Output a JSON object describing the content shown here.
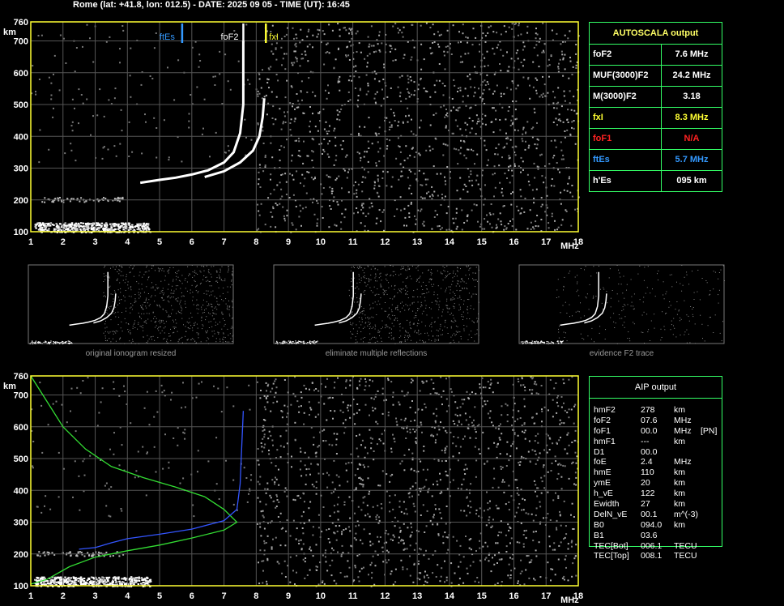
{
  "header": {
    "title": "Rome (lat: +41.8, lon: 012.5) - DATE: 2025 09 05 - TIME (UT): 16:45"
  },
  "chart_data": [
    {
      "type": "scatter",
      "panel": "main-ionogram",
      "xlabel": "MHz",
      "ylabel": "km",
      "xlim": [
        1,
        18
      ],
      "ylim": [
        100,
        760
      ],
      "x_ticks": [
        1,
        2,
        3,
        4,
        5,
        6,
        7,
        8,
        9,
        10,
        11,
        12,
        13,
        14,
        15,
        16,
        17,
        18
      ],
      "y_ticks": [
        100,
        200,
        300,
        400,
        500,
        600,
        700,
        760
      ],
      "grid": true,
      "markers": [
        {
          "label": "ftEs",
          "x": 5.7,
          "color": "#3399ff"
        },
        {
          "label": "foF2",
          "x": 7.6,
          "color": "#ffffff"
        },
        {
          "label": "fxI",
          "x": 8.3,
          "color": "#ffff33"
        }
      ],
      "series": [
        {
          "color": "#ffffff",
          "points": [
            [
              4.4,
              254
            ],
            [
              5.0,
              263
            ],
            [
              5.5,
              270
            ],
            [
              6.0,
              280
            ],
            [
              6.5,
              293
            ],
            [
              7.0,
              318
            ],
            [
              7.3,
              350
            ],
            [
              7.5,
              410
            ],
            [
              7.6,
              500
            ],
            [
              7.6,
              640
            ],
            [
              7.6,
              700
            ]
          ]
        },
        {
          "color": "#ffffff",
          "points": [
            [
              6.4,
              272
            ],
            [
              7.0,
              290
            ],
            [
              7.5,
              318
            ],
            [
              7.9,
              355
            ],
            [
              8.1,
              400
            ],
            [
              8.2,
              460
            ],
            [
              8.25,
              520
            ]
          ]
        }
      ]
    },
    {
      "type": "scatter",
      "panel": "aip-ionogram",
      "xlabel": "MHz",
      "ylabel": "km",
      "xlim": [
        1,
        18
      ],
      "ylim": [
        100,
        760
      ],
      "x_ticks": [
        1,
        2,
        3,
        4,
        5,
        6,
        7,
        8,
        9,
        10,
        11,
        12,
        13,
        14,
        15,
        16,
        17,
        18
      ],
      "y_ticks": [
        100,
        200,
        300,
        400,
        500,
        600,
        700,
        760
      ],
      "grid": true,
      "series": [
        {
          "color": "#33dd33",
          "points": [
            [
              1.0,
              760
            ],
            [
              1.5,
              680
            ],
            [
              2.0,
              600
            ],
            [
              2.7,
              530
            ],
            [
              3.5,
              475
            ],
            [
              4.5,
              440
            ],
            [
              5.5,
              410
            ],
            [
              6.4,
              380
            ],
            [
              7.0,
              340
            ],
            [
              7.4,
              300
            ],
            [
              7.0,
              275
            ],
            [
              6.0,
              250
            ],
            [
              5.0,
              228
            ],
            [
              4.0,
              210
            ],
            [
              3.0,
              190
            ],
            [
              2.2,
              160
            ],
            [
              1.5,
              120
            ],
            [
              1.0,
              105
            ]
          ]
        },
        {
          "color": "#3355ff",
          "points": [
            [
              2.5,
              215
            ],
            [
              3.0,
              220
            ],
            [
              3.5,
              235
            ],
            [
              4.0,
              248
            ],
            [
              5.0,
              262
            ],
            [
              6.0,
              278
            ],
            [
              7.0,
              305
            ],
            [
              7.4,
              340
            ],
            [
              7.5,
              420
            ],
            [
              7.55,
              540
            ],
            [
              7.6,
              650
            ]
          ]
        }
      ]
    }
  ],
  "thumbnails": [
    {
      "caption": "original ionogram resized"
    },
    {
      "caption": "eliminate multiple reflections"
    },
    {
      "caption": "evidence F2 trace"
    }
  ],
  "autoscala": {
    "title": "AUTOSCALA output",
    "rows": [
      {
        "key": "foF2",
        "value": "7.6 MHz",
        "color": "#ffffff"
      },
      {
        "key": "MUF(3000)F2",
        "value": "24.2 MHz",
        "color": "#ffffff"
      },
      {
        "key": "M(3000)F2",
        "value": "3.18",
        "color": "#ffffff"
      },
      {
        "key": "fxI",
        "value": "8.3 MHz",
        "color": "#ffff33"
      },
      {
        "key": "foF1",
        "value": "N/A",
        "color": "#ff2222"
      },
      {
        "key": "ftEs",
        "value": "5.7 MHz",
        "color": "#3399ff"
      },
      {
        "key": "h'Es",
        "value": "095    km",
        "color": "#ffffff"
      }
    ]
  },
  "aip": {
    "title": "AIP output",
    "rows": [
      {
        "name": "hmF2",
        "value": "278",
        "unit": "km",
        "extra": ""
      },
      {
        "name": "foF2",
        "value": "07.6",
        "unit": "MHz",
        "extra": ""
      },
      {
        "name": "foF1",
        "value": "00.0",
        "unit": "MHz",
        "extra": "[PN]"
      },
      {
        "name": "hmF1",
        "value": "---",
        "unit": "km",
        "extra": ""
      },
      {
        "name": "D1",
        "value": "00.0",
        "unit": "",
        "extra": ""
      },
      {
        "name": "foE",
        "value": "2.4",
        "unit": "MHz",
        "extra": ""
      },
      {
        "name": "hmE",
        "value": "110",
        "unit": "km",
        "extra": ""
      },
      {
        "name": "ymE",
        "value": "20",
        "unit": "km",
        "extra": ""
      },
      {
        "name": "h_vE",
        "value": "122",
        "unit": "km",
        "extra": ""
      },
      {
        "name": "Ewidth",
        "value": "27",
        "unit": "km",
        "extra": ""
      },
      {
        "name": "DelN_vE",
        "value": "00.1",
        "unit": "m^(-3)",
        "extra": ""
      },
      {
        "name": "B0",
        "value": "094.0",
        "unit": "km",
        "extra": ""
      },
      {
        "name": "B1",
        "value": "03.6",
        "unit": "",
        "extra": ""
      },
      {
        "name": "TEC[Bot]",
        "value": "006.1",
        "unit": "TECU",
        "extra": ""
      },
      {
        "name": "TEC[Top]",
        "value": "008.1",
        "unit": "TECU",
        "extra": ""
      }
    ]
  }
}
